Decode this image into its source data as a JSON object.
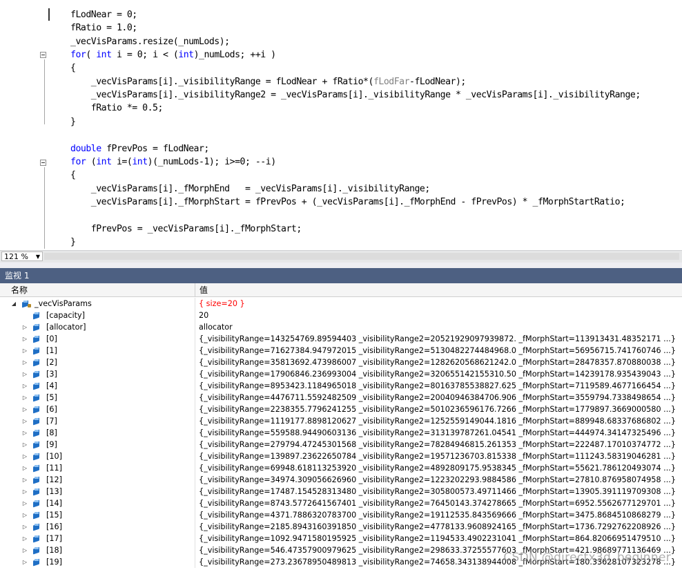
{
  "editor": {
    "lines": [
      {
        "parts": [
          {
            "t": "fLodNear = 0;"
          }
        ]
      },
      {
        "parts": [
          {
            "t": "fRatio = 1.0;"
          }
        ]
      },
      {
        "parts": [
          {
            "t": "_vecVisParams.resize(_numLods);"
          }
        ]
      },
      {
        "parts": [
          {
            "t": "for",
            "c": "kw"
          },
          {
            "t": "( "
          },
          {
            "t": "int",
            "c": "kw"
          },
          {
            "t": " i = 0; i < ("
          },
          {
            "t": "int",
            "c": "kw"
          },
          {
            "t": ")_numLods; ++i )"
          }
        ]
      },
      {
        "parts": [
          {
            "t": "{"
          }
        ]
      },
      {
        "parts": [
          {
            "t": "    _vecVisParams[i]._visibilityRange = fLodNear + fRatio*("
          },
          {
            "t": "fLodFar",
            "c": "gray"
          },
          {
            "t": "-fLodNear);"
          }
        ]
      },
      {
        "parts": [
          {
            "t": "    _vecVisParams[i]._visibilityRange2 = _vecVisParams[i]._visibilityRange * _vecVisParams[i]._visibilityRange;"
          }
        ]
      },
      {
        "parts": [
          {
            "t": "    fRatio *= 0.5;"
          }
        ]
      },
      {
        "parts": [
          {
            "t": "}"
          }
        ]
      },
      {
        "parts": [
          {
            "t": ""
          }
        ]
      },
      {
        "parts": [
          {
            "t": "double",
            "c": "kw"
          },
          {
            "t": " fPrevPos = fLodNear;"
          }
        ]
      },
      {
        "parts": [
          {
            "t": "for",
            "c": "kw"
          },
          {
            "t": " ("
          },
          {
            "t": "int",
            "c": "kw"
          },
          {
            "t": " i=("
          },
          {
            "t": "int",
            "c": "kw"
          },
          {
            "t": ")(_numLods-1); i>=0; --i)"
          }
        ]
      },
      {
        "parts": [
          {
            "t": "{"
          }
        ]
      },
      {
        "parts": [
          {
            "t": "    _vecVisParams[i]._fMorphEnd   = _vecVisParams[i]._visibilityRange;"
          }
        ]
      },
      {
        "parts": [
          {
            "t": "    _vecVisParams[i]._fMorphStart = fPrevPos + (_vecVisParams[i]._fMorphEnd - fPrevPos) * _fMorphStartRatio;"
          }
        ]
      },
      {
        "parts": [
          {
            "t": ""
          }
        ]
      },
      {
        "parts": [
          {
            "t": "    fPrevPos = _vecVisParams[i]._fMorphStart;"
          }
        ]
      },
      {
        "parts": [
          {
            "t": "}"
          }
        ]
      }
    ],
    "zoom": "121 %"
  },
  "watch": {
    "title": "监视 1",
    "col_name": "名称",
    "col_value": "值",
    "root": {
      "name": "_vecVisParams",
      "value": "{ size=20 }"
    },
    "capacity": {
      "name": "[capacity]",
      "value": "20"
    },
    "allocator": {
      "name": "[allocator]",
      "value": "allocator"
    },
    "items": [
      {
        "name": "[0]",
        "value": "{_visibilityRange=143254769.89594403 _visibilityRange2=20521929097939872. _fMorphStart=113913431.48352171 ...}"
      },
      {
        "name": "[1]",
        "value": "{_visibilityRange=71627384.947972015 _visibilityRange2=5130482274484968.0 _fMorphStart=56956715.741760746 ...}"
      },
      {
        "name": "[2]",
        "value": "{_visibilityRange=35813692.473986007 _visibilityRange2=1282620568621242.0 _fMorphStart=28478357.870880038 ...}"
      },
      {
        "name": "[3]",
        "value": "{_visibilityRange=17906846.236993004 _visibilityRange2=320655142155310.50 _fMorphStart=14239178.935439043 ...}"
      },
      {
        "name": "[4]",
        "value": "{_visibilityRange=8953423.1184965018 _visibilityRange2=80163785538827.625 _fMorphStart=7119589.4677166454 ...}"
      },
      {
        "name": "[5]",
        "value": "{_visibilityRange=4476711.5592482509 _visibilityRange2=20040946384706.906 _fMorphStart=3559794.7338498654 ...}"
      },
      {
        "name": "[6]",
        "value": "{_visibilityRange=2238355.7796241255 _visibilityRange2=5010236596176.7266 _fMorphStart=1779897.3669000580 ...}"
      },
      {
        "name": "[7]",
        "value": "{_visibilityRange=1119177.8898120627 _visibilityRange2=1252559149044.1816 _fMorphStart=889948.68337686802 ...}"
      },
      {
        "name": "[8]",
        "value": "{_visibilityRange=559588.94490603136 _visibilityRange2=313139787261.04541 _fMorphStart=444974.34147325496 ...}"
      },
      {
        "name": "[9]",
        "value": "{_visibilityRange=279794.47245301568 _visibilityRange2=78284946815.261353 _fMorphStart=222487.17010374772 ...}"
      },
      {
        "name": "[10]",
        "value": "{_visibilityRange=139897.23622650784 _visibilityRange2=19571236703.815338 _fMorphStart=111243.58319046281 ...}"
      },
      {
        "name": "[11]",
        "value": "{_visibilityRange=69948.618113253920 _visibilityRange2=4892809175.9538345 _fMorphStart=55621.786120493074 ...}"
      },
      {
        "name": "[12]",
        "value": "{_visibilityRange=34974.309056626960 _visibilityRange2=1223202293.9884586 _fMorphStart=27810.876958074958 ...}"
      },
      {
        "name": "[13]",
        "value": "{_visibilityRange=17487.154528313480 _visibilityRange2=305800573.49711466 _fMorphStart=13905.391119709308 ...}"
      },
      {
        "name": "[14]",
        "value": "{_visibilityRange=8743.5772641567401 _visibilityRange2=76450143.374278665 _fMorphStart=6952.5562677129701 ...}"
      },
      {
        "name": "[15]",
        "value": "{_visibilityRange=4371.7886320783700 _visibilityRange2=19112535.843569666 _fMorphStart=3475.8684510868279 ...}"
      },
      {
        "name": "[16]",
        "value": "{_visibilityRange=2185.8943160391850 _visibilityRange2=4778133.9608924165 _fMorphStart=1736.7292762208926 ...}"
      },
      {
        "name": "[17]",
        "value": "{_visibilityRange=1092.9471580195925 _visibilityRange2=1194533.4902231041 _fMorphStart=864.82066951479510 ...}"
      },
      {
        "name": "[18]",
        "value": "{_visibilityRange=546.47357900979625 _visibilityRange2=298633.37255577603 _fMorphStart=421.98689771136469 ...}"
      },
      {
        "name": "[19]",
        "value": "{_visibilityRange=273.23678950489813 _visibilityRange2=74658.343138944008 _fMorphStart=180.33628107323278 ...}"
      }
    ]
  },
  "watermark": "CSDN @directx3d_beginner"
}
